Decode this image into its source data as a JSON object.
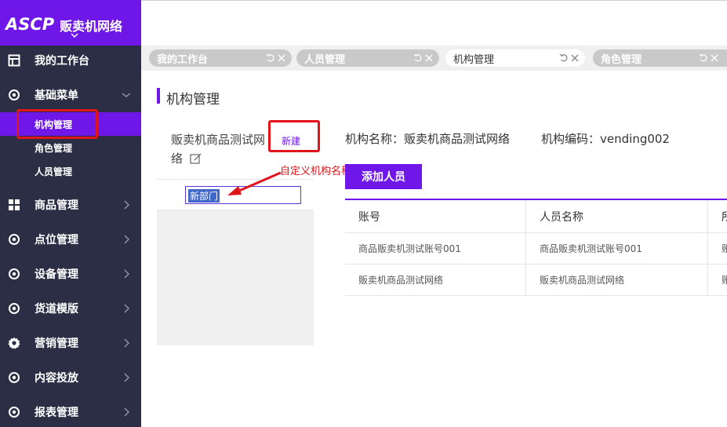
{
  "brand": {
    "logo": "ASCP",
    "name": "贩卖机网络"
  },
  "sidebar": {
    "items": [
      {
        "label": "我的工作台",
        "icon": "dashboard-icon"
      },
      {
        "label": "基础菜单",
        "icon": "circle-dot-icon"
      },
      {
        "label": "商品管理",
        "icon": "grid-icon"
      },
      {
        "label": "点位管理",
        "icon": "circle-dot-icon"
      },
      {
        "label": "设备管理",
        "icon": "circle-dot-icon"
      },
      {
        "label": "货道模版",
        "icon": "circle-dot-icon"
      },
      {
        "label": "营销管理",
        "icon": "gear-icon"
      },
      {
        "label": "内容投放",
        "icon": "circle-dot-icon"
      },
      {
        "label": "报表管理",
        "icon": "circle-dot-icon"
      }
    ],
    "submenu": [
      {
        "label": "机构管理",
        "active": true
      },
      {
        "label": "角色管理",
        "active": false
      },
      {
        "label": "人员管理",
        "active": false
      }
    ]
  },
  "tabs": [
    {
      "label": "我的工作台",
      "active": false
    },
    {
      "label": "人员管理",
      "active": false
    },
    {
      "label": "机构管理",
      "active": true
    },
    {
      "label": "角色管理",
      "active": false
    }
  ],
  "page": {
    "title": "机构管理"
  },
  "tree": {
    "root_label": "贩卖机商品测试网络",
    "new_label": "新建",
    "new_dept_value": "新部门"
  },
  "annotation": {
    "text": "自定义机构名称"
  },
  "info": {
    "org_name_label": "机构名称：",
    "org_name_value": "贩卖机商品测试网络",
    "org_code_label": "机构编码：",
    "org_code_value": "vending002"
  },
  "add_button": "添加人员",
  "table": {
    "headers": [
      "账号",
      "人员名称",
      "所"
    ],
    "rows": [
      [
        "商品贩卖机测试账号001",
        "商品贩卖机测试账号001",
        "账"
      ],
      [
        "贩卖机商品测试网络",
        "贩卖机商品测试网络",
        "账"
      ]
    ]
  },
  "colors": {
    "accent": "#6e17e8",
    "sidebar_bg": "#2b2e44",
    "annotation": "#e1141b"
  }
}
